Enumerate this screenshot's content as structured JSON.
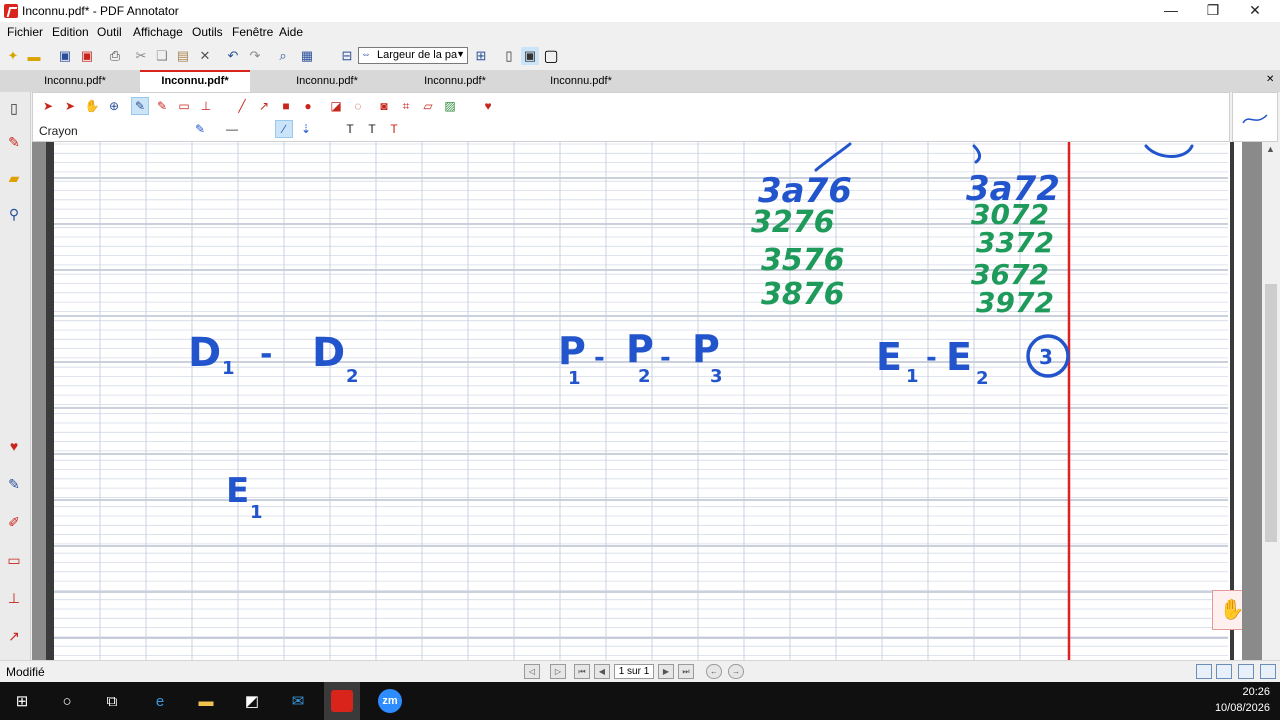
{
  "window": {
    "title": "Inconnu.pdf* - PDF Annotator",
    "minimize": "—",
    "maximize": "❐",
    "close": "✕"
  },
  "menu": [
    "Fichier",
    "Edition",
    "Outil",
    "Affichage",
    "Outils",
    "Fenêtre",
    "Aide"
  ],
  "toolbar": {
    "zoom_value": "Largeur de la page"
  },
  "tabs": [
    "Inconnu.pdf*",
    "Inconnu.pdf*",
    "Inconnu.pdf*",
    "Inconnu.pdf*",
    "Inconnu.pdf*"
  ],
  "active_tab_index": 1,
  "annotation_toolbar": {
    "current_tool": "Crayon",
    "pen_color": "#2255cc"
  },
  "handwriting": {
    "blue_numbers": [
      "3a76",
      "3a72"
    ],
    "green_left": [
      "3276",
      "3576",
      "3876"
    ],
    "green_right": [
      "3072",
      "3372",
      "3672",
      "3972"
    ],
    "group_d": {
      "a": "D",
      "a_sub": "1",
      "dash": "-",
      "b": "D",
      "b_sub": "2"
    },
    "group_p": {
      "a": "P",
      "a_sub": "1",
      "b": "P",
      "b_sub": "2",
      "c": "P",
      "c_sub": "3",
      "dash": "-"
    },
    "group_e": {
      "a": "E",
      "a_sub": "1",
      "dash": "-",
      "b": "E",
      "b_sub": "2"
    },
    "circled": "3",
    "e_single": {
      "letter": "E",
      "sub": "1"
    }
  },
  "status": {
    "text": "Modifié",
    "page_indicator": "1 sur 1"
  },
  "taskbar": {
    "time": "20:26",
    "date": "10/08/2026",
    "zoom_label": "zm"
  },
  "colors": {
    "accent_red": "#d9241c",
    "ink_blue": "#2255cc",
    "ink_green": "#1e9a5a",
    "grid_line": "#b8c4d8",
    "margin_red": "#e02020"
  }
}
